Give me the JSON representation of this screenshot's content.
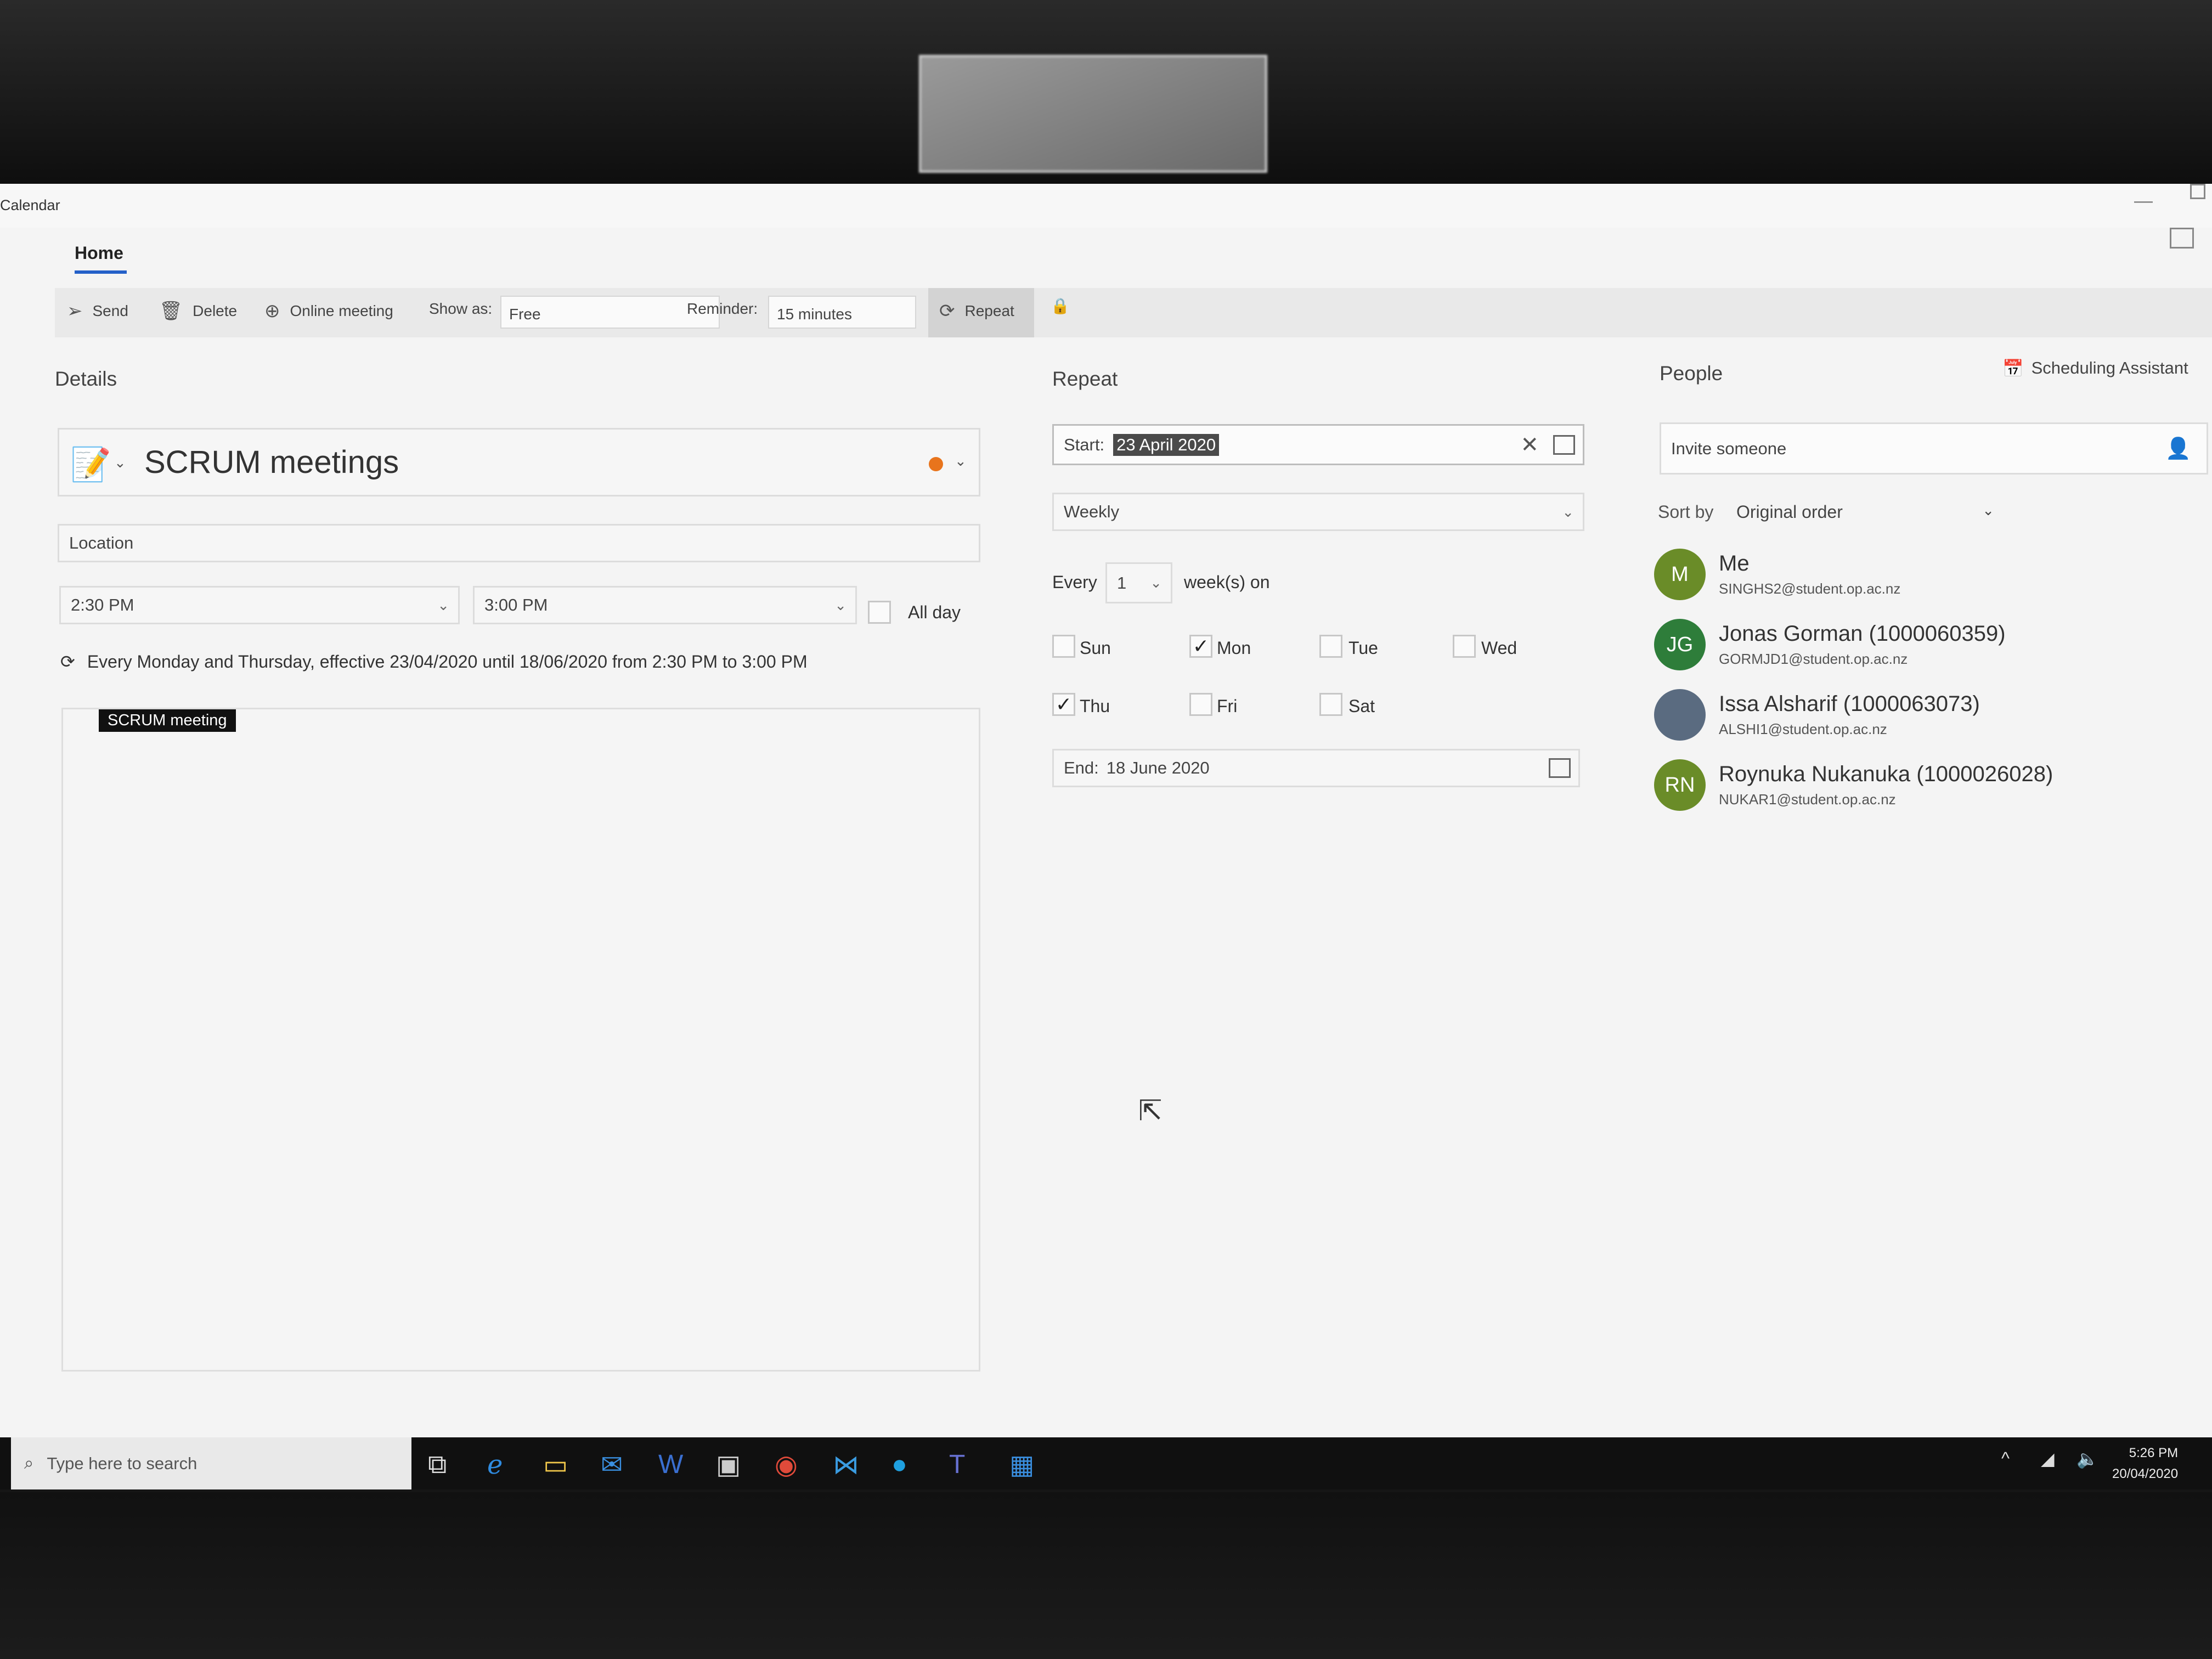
{
  "app": {
    "title": "Calendar",
    "home_tab": "Home"
  },
  "toolbar": {
    "send": "Send",
    "delete": "Delete",
    "online_meeting": "Online meeting",
    "show_as_label": "Show as:",
    "show_as_value": "Free",
    "reminder_label": "Reminder:",
    "reminder_value": "15 minutes",
    "repeat": "Repeat"
  },
  "details": {
    "heading": "Details",
    "event_title": "SCRUM meetings",
    "location_placeholder": "Location",
    "start_time": "2:30 PM",
    "end_time": "3:00 PM",
    "all_day": "All day",
    "summary": "Every Monday and Thursday, effective 23/04/2020 until 18/06/2020 from 2:30 PM to 3:00 PM",
    "notes_text": "SCRUM meeting"
  },
  "repeat": {
    "heading": "Repeat",
    "start_label": "Start:",
    "start_value": "23 April 2020",
    "frequency": "Weekly",
    "every_label": "Every",
    "interval": "1",
    "unit_label": "week(s) on",
    "days": [
      {
        "label": "Sun",
        "checked": false
      },
      {
        "label": "Mon",
        "checked": true
      },
      {
        "label": "Tue",
        "checked": false
      },
      {
        "label": "Wed",
        "checked": false
      },
      {
        "label": "Thu",
        "checked": true
      },
      {
        "label": "Fri",
        "checked": false
      },
      {
        "label": "Sat",
        "checked": false
      }
    ],
    "end_label": "End:",
    "end_value": "18 June 2020"
  },
  "people": {
    "heading": "People",
    "scheduling_assistant": "Scheduling Assistant",
    "invite_placeholder": "Invite someone",
    "sort_label": "Sort by",
    "sort_value": "Original order",
    "list": [
      {
        "initials": "M",
        "name": "Me",
        "email": "SINGHS2@student.op.ac.nz",
        "color": "#6a8c28"
      },
      {
        "initials": "JG",
        "name": "Jonas Gorman (1000060359)",
        "email": "GORMJD1@student.op.ac.nz",
        "color": "#2e7d3a"
      },
      {
        "initials": "",
        "name": "Issa Alsharif (1000063073)",
        "email": "ALSHI1@student.op.ac.nz",
        "color": "#5a6b80"
      },
      {
        "initials": "RN",
        "name": "Roynuka Nukanuka (1000026028)",
        "email": "NUKAR1@student.op.ac.nz",
        "color": "#6a8c28"
      }
    ]
  },
  "taskbar": {
    "search_placeholder": "Type here to search",
    "time": "5:26 PM",
    "date": "20/04/2020"
  }
}
